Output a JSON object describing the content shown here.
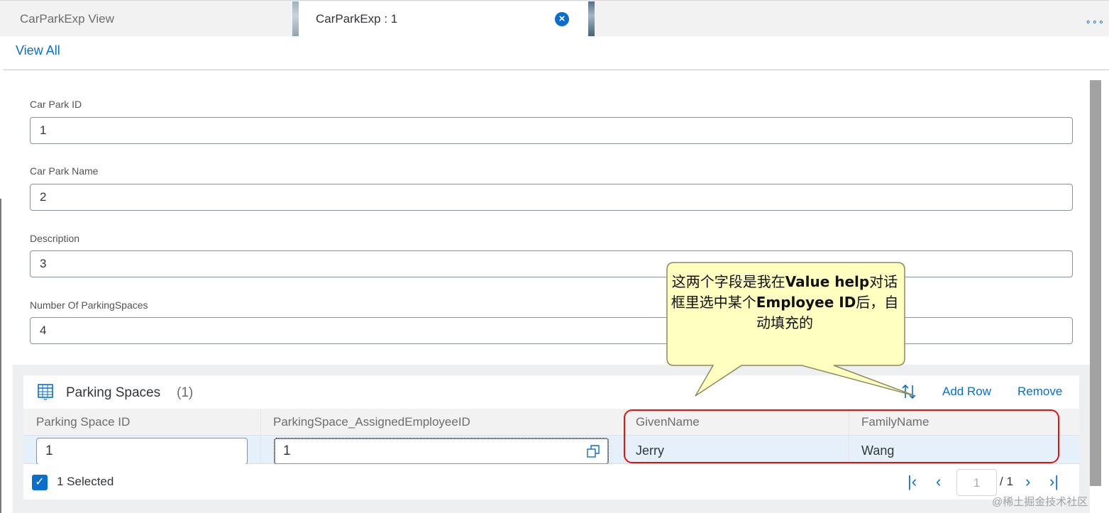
{
  "tabs": [
    {
      "label": "CarParkExp View",
      "active": false
    },
    {
      "label": "CarParkExp : 1",
      "active": true
    }
  ],
  "overflow_label": "∘∘∘",
  "nav": {
    "view_all": "View All"
  },
  "form": {
    "fields": [
      {
        "label": "Car Park ID",
        "value": "1"
      },
      {
        "label": "Car Park Name",
        "value": "2"
      },
      {
        "label": "Description",
        "value": "3"
      },
      {
        "label": "Number Of ParkingSpaces",
        "value": "4"
      }
    ]
  },
  "table": {
    "title": "Parking Spaces",
    "count": "(1)",
    "toolbar": {
      "add_row": "Add Row",
      "remove": "Remove"
    },
    "columns": [
      "Parking Space ID",
      "ParkingSpace_AssignedEmployeeID",
      "GivenName",
      "FamilyName"
    ],
    "rows": [
      {
        "parking_space_id": "1",
        "assigned_employee_id": "1",
        "given_name": "Jerry",
        "family_name": "Wang"
      }
    ],
    "footer": {
      "selected": "1 Selected",
      "page_value": "1",
      "page_total": "/ 1"
    }
  },
  "callout": {
    "part1": "这两个字段是我在",
    "bold1": "Value help",
    "part2": "对话框里选中某个",
    "bold2": "Employee ID",
    "part3": "后，自动填充的"
  },
  "watermark": "@稀土掘金技术社区",
  "colors": {
    "accent": "#0a6ed1",
    "highlight": "#e0140f",
    "callout_fill": "#ffffc0"
  }
}
